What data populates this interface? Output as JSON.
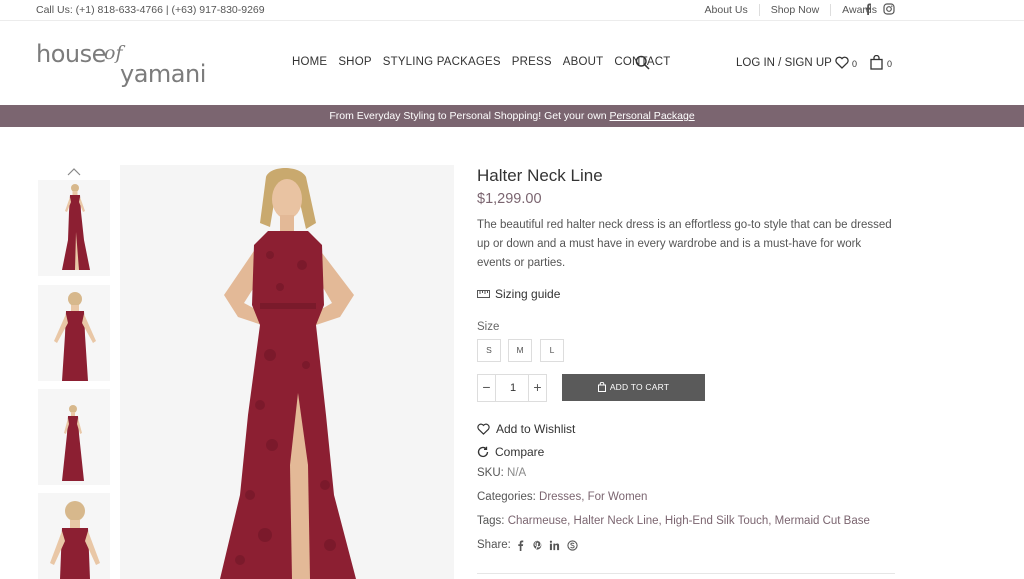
{
  "topbar": {
    "contact": "Call Us:  (+1) 818-633-4766 | (+63) 917-830-9269",
    "links": [
      "About Us",
      "Shop Now",
      "Awards"
    ]
  },
  "header": {
    "logo_words": [
      "house",
      "of",
      "yamani"
    ],
    "nav": [
      "HOME",
      "SHOP",
      "STYLING PACKAGES",
      "PRESS",
      "ABOUT",
      "CONTACT"
    ],
    "account": "LOG IN / SIGN UP",
    "wishlist_count": "0",
    "cart_count": "0"
  },
  "promo": {
    "text": "From Everyday Styling to Personal Shopping! Get your own ",
    "link": "Personal Package"
  },
  "product": {
    "title": "Halter Neck Line",
    "price": "$1,299.00",
    "description": "The beautiful red halter neck dress is an effortless go-to style that can be dressed up or down and a must have in every wardrobe and is a must-have for work events or parties.",
    "sizing_guide": "Sizing guide",
    "size_label": "Size",
    "sizes": [
      "S",
      "M",
      "L"
    ],
    "quantity": "1",
    "add_to_cart": "ADD TO CART",
    "wishlist": "Add to Wishlist",
    "compare": "Compare",
    "sku_label": "SKU:",
    "sku_value": "N/A",
    "categories_label": "Categories:",
    "categories": "Dresses, For Women",
    "tags_label": "Tags:",
    "tags": "Charmeuse, Halter Neck Line, High-End Silk Touch, Mermaid Cut Base",
    "share_label": "Share:"
  },
  "icons": {
    "social_top": [
      "facebook-icon",
      "instagram-icon"
    ],
    "share": [
      "facebook-icon",
      "pinterest-icon",
      "linkedin-icon",
      "skype-icon"
    ]
  },
  "colors": {
    "accent": "#7b6570",
    "dress": "#8c1f32",
    "button": "#5a5a5a"
  }
}
